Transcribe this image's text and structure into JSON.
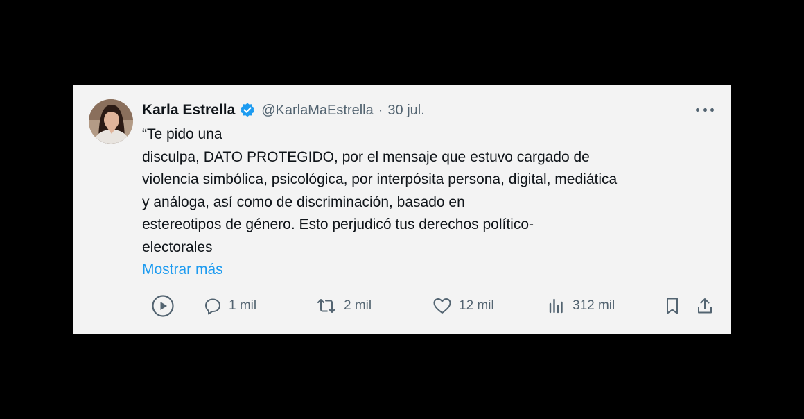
{
  "author": {
    "name": "Karla Estrella",
    "handle": "@KarlaMaEstrella",
    "separator": "·",
    "date": "30 jul.",
    "verified": true,
    "verified_color": "#1d9bf0"
  },
  "tweet": {
    "lines": [
      "“Te pido una",
      "disculpa, DATO PROTEGIDO, por el mensaje que estuvo cargado de",
      "violencia simbólica, psicológica, por interpósita persona, digital, mediática",
      "y análoga, así como de discriminación, basado en",
      "estereotipos de género. Esto perjudicó tus derechos político-",
      "electorales"
    ],
    "show_more": "Mostrar más"
  },
  "actions": {
    "play": {
      "icon": "play-icon"
    },
    "reply": {
      "icon": "reply-icon",
      "count": "1 mil"
    },
    "retweet": {
      "icon": "retweet-icon",
      "count": "2 mil"
    },
    "like": {
      "icon": "heart-icon",
      "count": "12 mil"
    },
    "views": {
      "icon": "views-icon",
      "count": "312 mil"
    },
    "bookmark": {
      "icon": "bookmark-icon"
    },
    "share": {
      "icon": "share-icon"
    }
  },
  "colors": {
    "background": "#000000",
    "card": "#f3f3f3",
    "text": "#0f1419",
    "secondary": "#536471",
    "link": "#1d9bf0"
  }
}
